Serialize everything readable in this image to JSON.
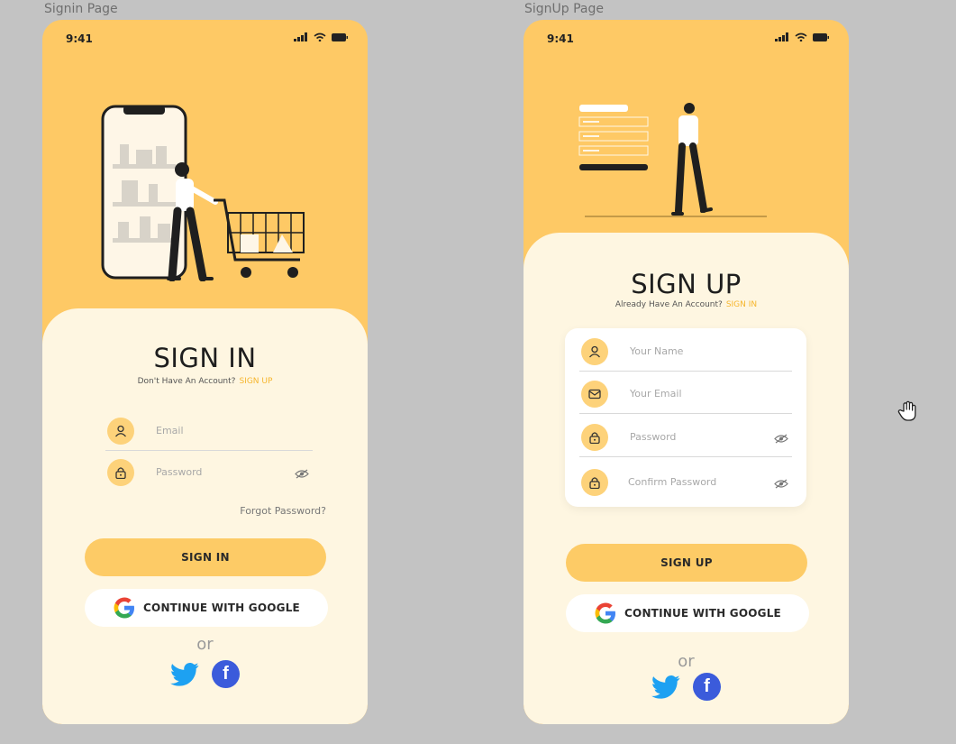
{
  "signin_frame": {
    "frame_label": "Signin Page",
    "status_time": "9:41",
    "title": "SIGN IN",
    "subtitle_text": "Don't Have An Account?",
    "subtitle_link": "SIGN UP",
    "fields": [
      {
        "placeholder": "Email",
        "icon": "user-icon"
      },
      {
        "placeholder": "Password",
        "icon": "lock-icon"
      }
    ],
    "forgot_password": "Forgot Password?",
    "primary_button": "SIGN IN",
    "google_button": "CONTINUE WITH GOOGLE",
    "or_text": "or"
  },
  "signup_frame": {
    "frame_label": "SignUp Page",
    "status_time": "9:41",
    "title": "SIGN UP",
    "subtitle_text": "Already Have An Account?",
    "subtitle_link": "SIGN IN",
    "fields": [
      {
        "placeholder": "Your Name",
        "icon": "user-icon"
      },
      {
        "placeholder": "Your Email",
        "icon": "mail-icon"
      },
      {
        "placeholder": "Password",
        "icon": "lock-icon"
      },
      {
        "placeholder": "Confirm Password",
        "icon": "lock-icon"
      }
    ],
    "primary_button": "SIGN UP",
    "google_button": "CONTINUE WITH GOOGLE",
    "or_text": "or"
  },
  "colors": {
    "accent_yellow": "#fec965",
    "sheet_cream": "#fef6e1",
    "link_gold": "#f6b62e",
    "facebook_blue": "#3b5bdb",
    "twitter_blue": "#1da1f2",
    "canvas_gray": "#c3c3c3"
  },
  "icons": [
    "user-icon",
    "lock-icon",
    "mail-icon",
    "eye-off-icon",
    "google-icon",
    "twitter-icon",
    "facebook-icon",
    "hand-cursor-icon"
  ]
}
